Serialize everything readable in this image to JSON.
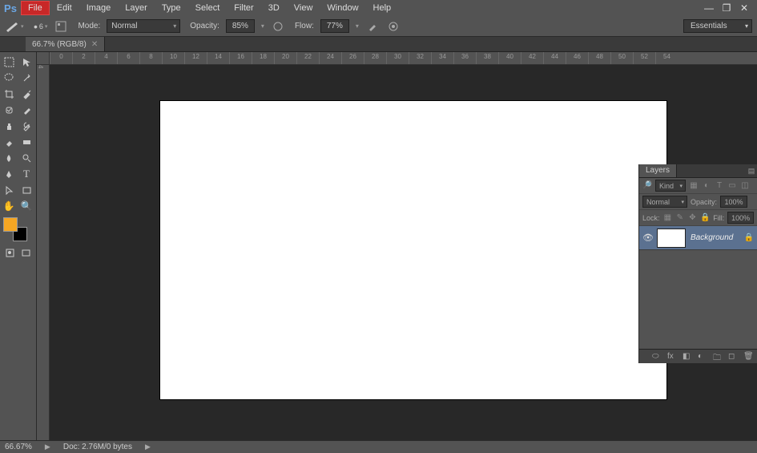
{
  "app": {
    "logo": "Ps"
  },
  "menu": {
    "file": "File",
    "edit": "Edit",
    "image": "Image",
    "layer": "Layer",
    "type": "Type",
    "select": "Select",
    "filter": "Filter",
    "threeD": "3D",
    "view": "View",
    "window": "Window",
    "help": "Help"
  },
  "options": {
    "brush_size": "6",
    "mode_label": "Mode:",
    "mode_value": "Normal",
    "opacity_label": "Opacity:",
    "opacity_value": "85%",
    "flow_label": "Flow:",
    "flow_value": "77%",
    "workspace": "Essentials"
  },
  "document": {
    "tab_title": "66.7% (RGB/8)"
  },
  "ruler": {
    "h": [
      "0",
      "2",
      "4",
      "6",
      "8",
      "10",
      "12",
      "14",
      "16",
      "18",
      "20",
      "22",
      "24",
      "26",
      "28",
      "30",
      "32",
      "34",
      "36",
      "38",
      "40",
      "42",
      "44",
      "46",
      "48",
      "50",
      "52",
      "54"
    ],
    "v_marker": "4"
  },
  "colors": {
    "foreground": "#f5a623",
    "background": "#000000"
  },
  "layers_panel": {
    "tab": "Layers",
    "kind_label": "Kind",
    "blend_mode": "Normal",
    "opacity_label": "Opacity:",
    "opacity_value": "100%",
    "lock_label": "Lock:",
    "fill_label": "Fill:",
    "fill_value": "100%",
    "layers": [
      {
        "name": "Background",
        "locked": true
      }
    ]
  },
  "status": {
    "zoom": "66.67%",
    "doc": "Doc: 2.76M/0 bytes"
  },
  "icons": {
    "minimize": "—",
    "maximize": "❐",
    "close": "✕",
    "search": "🔍",
    "eye": "👁",
    "lock": "🔒",
    "trash": "🗑",
    "folder": "🗀",
    "link": "⬭",
    "mask": "◧",
    "fx": "fx",
    "adjust": "◐",
    "new": "◻"
  }
}
